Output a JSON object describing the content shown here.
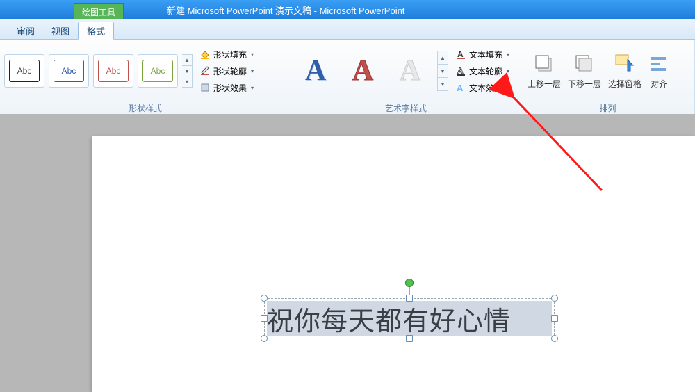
{
  "title": "新建 Microsoft PowerPoint 演示文稿 - Microsoft PowerPoint",
  "contextual_tab": "绘图工具",
  "tabs": {
    "review": "审阅",
    "view": "视图",
    "format": "格式"
  },
  "shape_styles": {
    "group_label": "形状样式",
    "thumb_label": "Abc",
    "fill": "形状填充",
    "outline": "形状轮廓",
    "effects": "形状效果"
  },
  "wordart": {
    "group_label": "艺术字样式",
    "sample": "A",
    "text_fill": "文本填充",
    "text_outline": "文本轮廓",
    "text_effects": "文本效果"
  },
  "arrange": {
    "group_label": "排列",
    "bring_forward": "上移一层",
    "send_backward": "下移一层",
    "selection_pane": "选择窗格",
    "align": "对齐"
  },
  "slide": {
    "textbox_content": "祝你每天都有好心情"
  }
}
